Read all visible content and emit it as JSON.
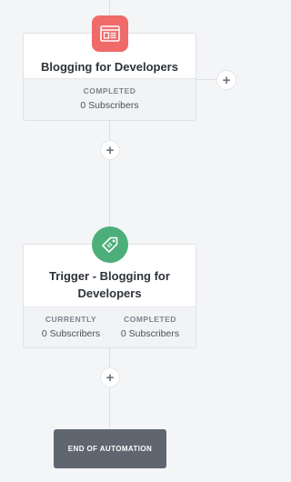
{
  "nodes": {
    "email": {
      "title": "Blogging for Developers",
      "icon": "newsletter-icon",
      "icon_color": "#f06a6a",
      "stats": [
        {
          "label": "COMPLETED",
          "value": "0 Subscribers"
        }
      ]
    },
    "trigger": {
      "title": "Trigger - Blogging for Developers",
      "icon": "tag-icon",
      "icon_color": "#4caf7a",
      "stats": [
        {
          "label": "CURRENTLY",
          "value": "0 Subscribers"
        },
        {
          "label": "COMPLETED",
          "value": "0 Subscribers"
        }
      ]
    }
  },
  "buttons": {
    "add_symbol": "+"
  },
  "end": {
    "label": "END OF AUTOMATION"
  }
}
